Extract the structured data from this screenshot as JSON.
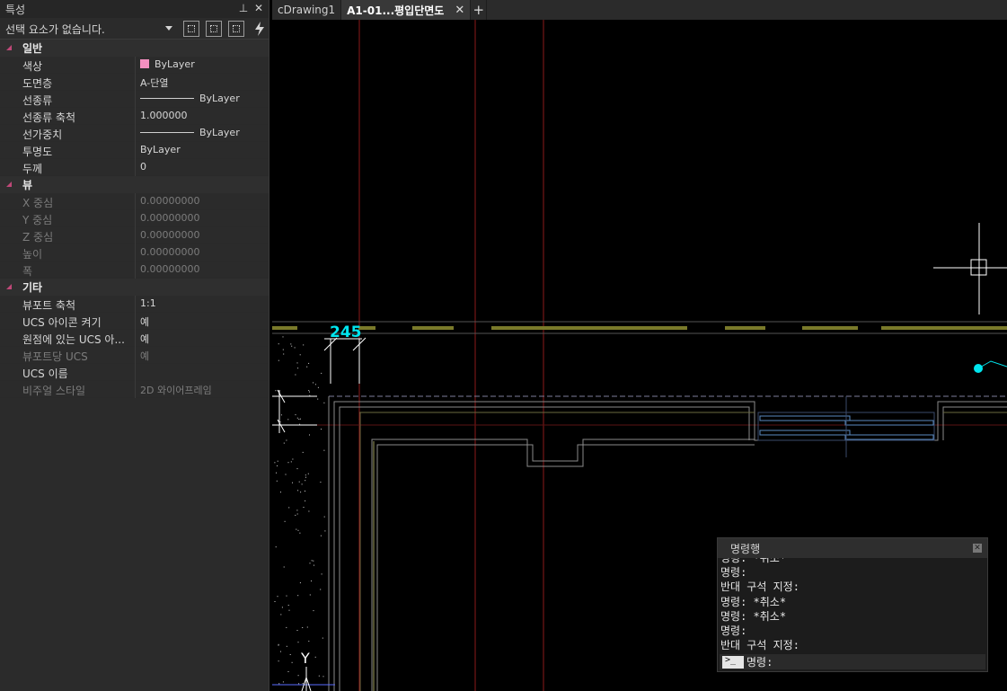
{
  "properties": {
    "title": "특성",
    "pin_glyph": "ⵠ",
    "close_glyph": "✕",
    "selection": "선택 요소가 없습니다.",
    "sections": [
      {
        "name": "일반",
        "rows": [
          {
            "key": "색상",
            "value": "ByLayer",
            "swatch": "#f48fc0"
          },
          {
            "key": "도면층",
            "value": "A-단열"
          },
          {
            "key": "선종류",
            "value": "ByLayer",
            "line": true
          },
          {
            "key": "선종류 축척",
            "value": "1.000000"
          },
          {
            "key": "선가중치",
            "value": "ByLayer",
            "line": true
          },
          {
            "key": "투명도",
            "value": "ByLayer"
          },
          {
            "key": "두께",
            "value": "0"
          }
        ]
      },
      {
        "name": "뷰",
        "rows": [
          {
            "key": "X 중심",
            "value": "0.00000000",
            "dim": true
          },
          {
            "key": "Y 중심",
            "value": "0.00000000",
            "dim": true
          },
          {
            "key": "Z 중심",
            "value": "0.00000000",
            "dim": true
          },
          {
            "key": "높이",
            "value": "0.00000000",
            "dim": true
          },
          {
            "key": "폭",
            "value": "0.00000000",
            "dim": true
          }
        ]
      },
      {
        "name": "기타",
        "rows": [
          {
            "key": "뷰포트 축척",
            "value": "1:1"
          },
          {
            "key": "UCS 아이콘 켜기",
            "value": "예"
          },
          {
            "key": "원점에 있는 UCS 아...",
            "value": "예"
          },
          {
            "key": "뷰포트당 UCS",
            "value": "예",
            "dim": true
          },
          {
            "key": "UCS 이름",
            "value": ""
          },
          {
            "key": "비주얼 스타일",
            "value": "2D 와이어프레임",
            "dim": true
          }
        ]
      }
    ]
  },
  "tabs": [
    {
      "label": "cDrawing1",
      "active": false
    },
    {
      "label": "A1-01...평입단면도",
      "active": true,
      "close": "✕"
    }
  ],
  "add_tab": "+",
  "drawing": {
    "dimension_text": "245",
    "ucs_y_label": "Y",
    "colors": {
      "background": "#000000",
      "red_lines": "#8b1a1a",
      "olive_dash": "#7a7a2a",
      "dimension": "#00e5ee",
      "wall": "#8a8a8a",
      "blue_line": "#5a6cff",
      "crosshair": "#ffffff"
    }
  },
  "command": {
    "title": "명령행",
    "close": "✕",
    "history": [
      "명령: *취소*",
      "명령:",
      "반대 구석 지정:",
      "명령: *취소*",
      "명령: *취소*",
      "명령:",
      "반대 구석 지정:"
    ],
    "prompt": "명령:"
  }
}
